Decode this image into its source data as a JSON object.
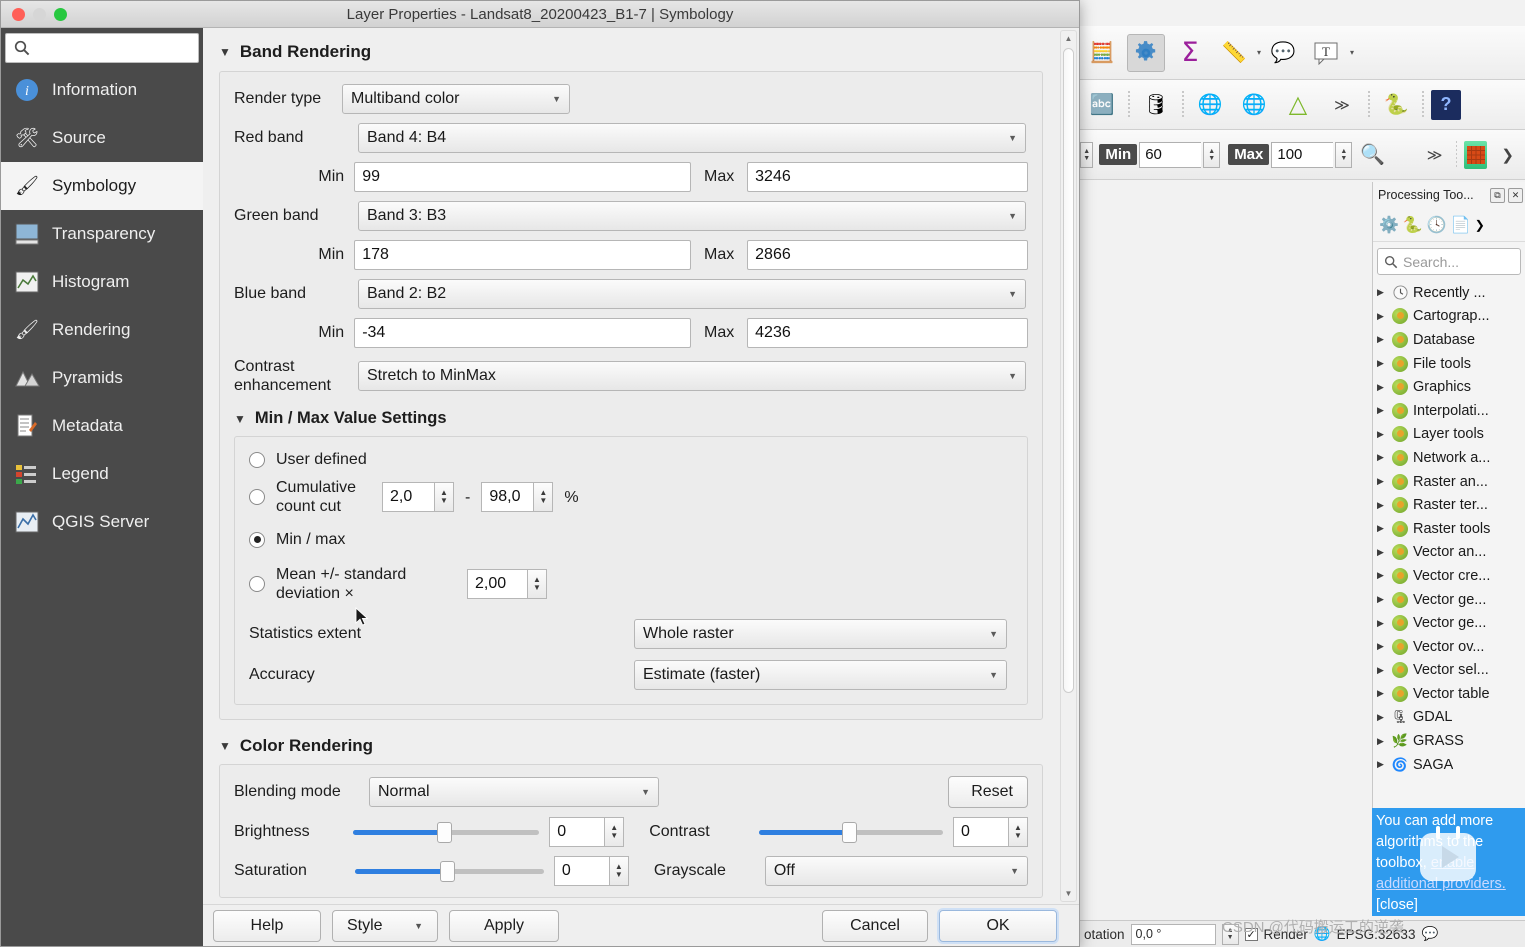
{
  "dialog": {
    "title": "Layer Properties - Landsat8_20200423_B1-7 | Symbology",
    "search_placeholder": "",
    "sidebar": [
      {
        "label": "Information",
        "icon": "info-icon"
      },
      {
        "label": "Source",
        "icon": "source-icon"
      },
      {
        "label": "Symbology",
        "icon": "symbology-icon"
      },
      {
        "label": "Transparency",
        "icon": "transparency-icon"
      },
      {
        "label": "Histogram",
        "icon": "histogram-icon"
      },
      {
        "label": "Rendering",
        "icon": "rendering-icon"
      },
      {
        "label": "Pyramids",
        "icon": "pyramids-icon"
      },
      {
        "label": "Metadata",
        "icon": "metadata-icon"
      },
      {
        "label": "Legend",
        "icon": "legend-icon"
      },
      {
        "label": "QGIS Server",
        "icon": "qgis-server-icon"
      }
    ],
    "band_rendering": {
      "group_title": "Band Rendering",
      "render_type_label": "Render type",
      "render_type_value": "Multiband color",
      "red_band_label": "Red band",
      "red_band_value": "Band 4: B4",
      "red_min_label": "Min",
      "red_min_value": "99",
      "red_max_label": "Max",
      "red_max_value": "3246",
      "green_band_label": "Green band",
      "green_band_value": "Band 3: B3",
      "green_min_label": "Min",
      "green_min_value": "178",
      "green_max_label": "Max",
      "green_max_value": "2866",
      "blue_band_label": "Blue band",
      "blue_band_value": "Band 2: B2",
      "blue_min_label": "Min",
      "blue_min_value": "-34",
      "blue_max_label": "Max",
      "blue_max_value": "4236",
      "contrast_label": "Contrast enhancement",
      "contrast_value": "Stretch to MinMax"
    },
    "minmax_settings": {
      "group_title": "Min / Max Value Settings",
      "user_defined_label": "User defined",
      "cumulative_label": "Cumulative count cut",
      "cumulative_low": "2,0",
      "cumulative_dash": "-",
      "cumulative_high": "98,0",
      "percent_symbol": "%",
      "minmax_label": "Min / max",
      "mean_label": "Mean +/- standard deviation ×",
      "mean_value": "2,00",
      "selected": "minmax",
      "statistics_extent_label": "Statistics extent",
      "statistics_extent_value": "Whole raster",
      "accuracy_label": "Accuracy",
      "accuracy_value": "Estimate (faster)"
    },
    "color_rendering": {
      "group_title": "Color Rendering",
      "blending_label": "Blending mode",
      "blending_value": "Normal",
      "reset_label": "Reset",
      "brightness_label": "Brightness",
      "brightness_value": "0",
      "contrast_label": "Contrast",
      "contrast_value": "0",
      "saturation_label": "Saturation",
      "saturation_value": "0",
      "grayscale_label": "Grayscale",
      "grayscale_value": "Off"
    },
    "buttons": {
      "help": "Help",
      "style": "Style",
      "apply": "Apply",
      "cancel": "Cancel",
      "ok": "OK"
    }
  },
  "qgis": {
    "toolbar_minmax": {
      "min_label": "Min",
      "min_value": "60",
      "max_label": "Max",
      "max_value": "100"
    },
    "processing_panel": {
      "title": "Processing Too...",
      "search_placeholder": "Search...",
      "items": [
        {
          "label": "Recently ...",
          "icon": "clock-icon"
        },
        {
          "label": "Cartograp...",
          "icon": "qgis-icon"
        },
        {
          "label": "Database",
          "icon": "qgis-icon"
        },
        {
          "label": "File tools",
          "icon": "qgis-icon"
        },
        {
          "label": "Graphics",
          "icon": "qgis-icon"
        },
        {
          "label": "Interpolati...",
          "icon": "qgis-icon"
        },
        {
          "label": "Layer tools",
          "icon": "qgis-icon"
        },
        {
          "label": "Network a...",
          "icon": "qgis-icon"
        },
        {
          "label": "Raster an...",
          "icon": "qgis-icon"
        },
        {
          "label": "Raster ter...",
          "icon": "qgis-icon"
        },
        {
          "label": "Raster tools",
          "icon": "qgis-icon"
        },
        {
          "label": "Vector an...",
          "icon": "qgis-icon"
        },
        {
          "label": "Vector cre...",
          "icon": "qgis-icon"
        },
        {
          "label": "Vector ge...",
          "icon": "qgis-icon"
        },
        {
          "label": "Vector ge...",
          "icon": "qgis-icon"
        },
        {
          "label": "Vector ov...",
          "icon": "qgis-icon"
        },
        {
          "label": "Vector sel...",
          "icon": "qgis-icon"
        },
        {
          "label": "Vector table",
          "icon": "qgis-icon"
        },
        {
          "label": "GDAL",
          "icon": "gdal-icon"
        },
        {
          "label": "GRASS",
          "icon": "grass-icon"
        },
        {
          "label": "SAGA",
          "icon": "saga-icon"
        }
      ]
    },
    "tip": {
      "text_1": "You can add more algorithms to the toolbox, ",
      "link": "enable additional providers.",
      "close": "[close]"
    },
    "status": {
      "rotation_label": "otation",
      "rotation_value": "0,0 °",
      "render_label": "Render",
      "crs": "EPSG:32633"
    },
    "watermark": "CSDN @代码搬运工的逆袭"
  }
}
